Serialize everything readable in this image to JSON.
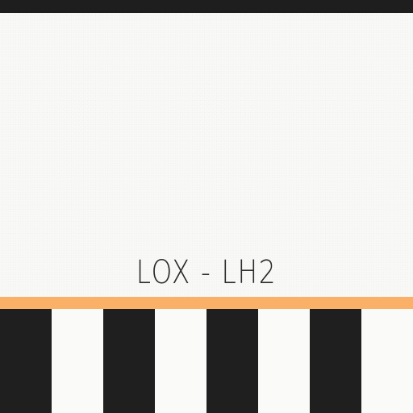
{
  "label": {
    "text": "LOX - LH2"
  },
  "colors": {
    "background": "#f8f8f7",
    "top_bar": "#1e1e1e",
    "orange_band": "#fbb068",
    "stripe_dark": "#1f1f1f",
    "stripe_light": "#fafaf9",
    "text": "#2a2a2a"
  }
}
